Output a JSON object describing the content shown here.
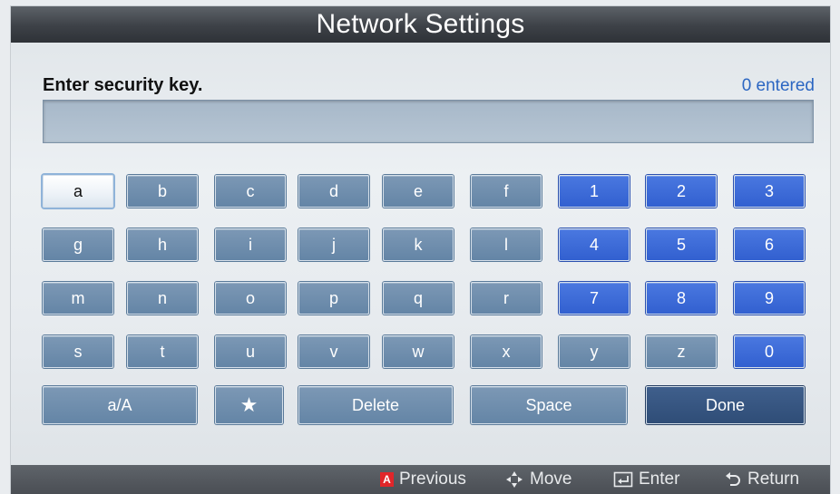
{
  "window": {
    "title": "Network Settings"
  },
  "prompt": {
    "label": "Enter security key.",
    "count": "0 entered"
  },
  "entry": {
    "value": ""
  },
  "keyboard": {
    "rows": [
      [
        "a",
        "b",
        "c",
        "d",
        "e",
        "f",
        "1",
        "2",
        "3"
      ],
      [
        "g",
        "h",
        "i",
        "j",
        "k",
        "l",
        "4",
        "5",
        "6"
      ],
      [
        "m",
        "n",
        "o",
        "p",
        "q",
        "r",
        "7",
        "8",
        "9"
      ],
      [
        "s",
        "t",
        "u",
        "v",
        "w",
        "x",
        "y",
        "z",
        "0"
      ]
    ],
    "bottom": {
      "case": "a/A",
      "symbol_icon": "star-icon",
      "delete": "Delete",
      "space": "Space",
      "done": "Done"
    },
    "selected": "a"
  },
  "footer": {
    "previous": {
      "badge": "A",
      "label": "Previous"
    },
    "move": {
      "icon": "dpad-arrows-icon",
      "label": "Move"
    },
    "enter": {
      "icon": "enter-icon",
      "label": "Enter"
    },
    "return": {
      "icon": "return-icon",
      "label": "Return"
    }
  },
  "colors": {
    "letter_key": "#6f8eae",
    "number_key": "#3b69d8",
    "done_key": "#35547f",
    "accent_text": "#2b66c2",
    "badge": "#e1262a"
  }
}
